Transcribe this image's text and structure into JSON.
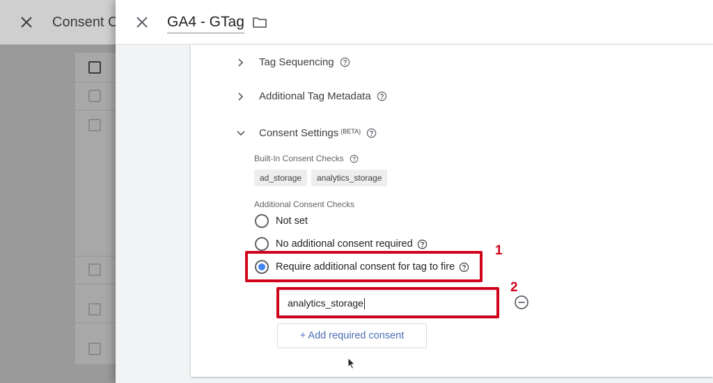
{
  "background_panel": {
    "title": "Consent C"
  },
  "header": {
    "tag_name": "GA4 - GTag"
  },
  "sections": {
    "tag_sequencing": "Tag Sequencing",
    "additional_metadata": "Additional Tag Metadata",
    "consent_settings": "Consent Settings",
    "consent_badge": "(BETA)"
  },
  "built_in": {
    "label": "Built-In Consent Checks",
    "chips": [
      "ad_storage",
      "analytics_storage"
    ]
  },
  "additional": {
    "label": "Additional Consent Checks",
    "options": [
      {
        "label": "Not set",
        "checked": false
      },
      {
        "label": "No additional consent required",
        "checked": false
      },
      {
        "label": "Require additional consent for tag to fire",
        "checked": true
      }
    ],
    "consent_value": "analytics_storage",
    "add_button": "+ Add required consent"
  },
  "annotations": {
    "marker_1": "1",
    "marker_2": "2",
    "color": "#d0021b"
  },
  "colors": {
    "radio_selected": "#4285f4",
    "link_blue": "#4a6fb5"
  }
}
